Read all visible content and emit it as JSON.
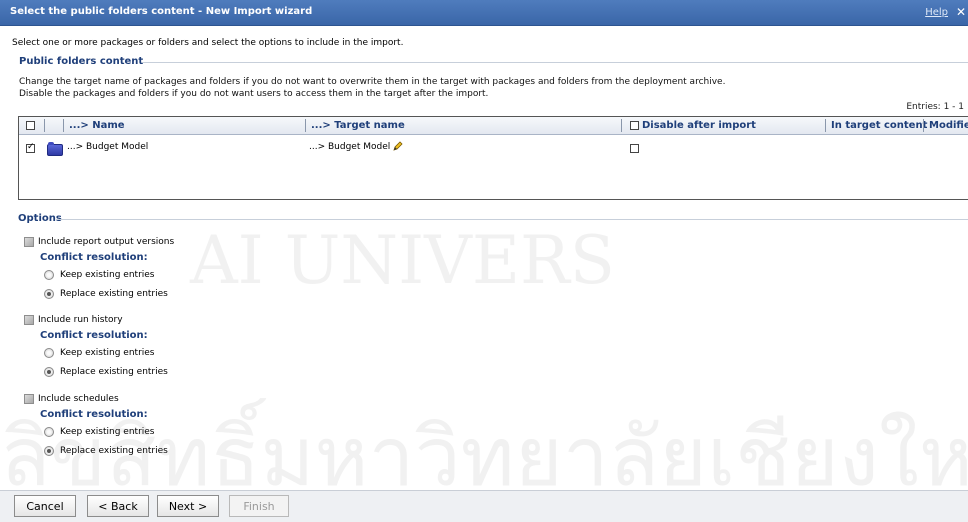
{
  "window": {
    "title": "Select the public folders content - New Import wizard",
    "help": "Help",
    "close": "✕"
  },
  "intro": "Select one or more packages or folders and select the options to include in the import.",
  "public_folders": {
    "title": "Public folders content",
    "desc1": "Change the target name of packages and folders if you do not want to overwrite them in the target with packages and folders from the deployment archive.",
    "desc2": "Disable the packages and folders if you do not want users to access them in the target after the import.",
    "entries": "Entries: 1 - 1",
    "columns": {
      "name": "...> Name",
      "target": "...> Target name",
      "disable": "Disable after import",
      "in_target": "In target content",
      "modified": "Modified"
    },
    "rows": [
      {
        "name": "...> Budget Model",
        "target": "...> Budget Model",
        "selected": true,
        "disable": false
      }
    ]
  },
  "options": {
    "title": "Options",
    "conflict_label": "Conflict resolution:",
    "keep": "Keep existing entries",
    "replace": "Replace existing entries",
    "groups": [
      {
        "label": "Include report output versions"
      },
      {
        "label": "Include run history"
      },
      {
        "label": "Include schedules"
      }
    ]
  },
  "footer": {
    "cancel": "Cancel",
    "back": "< Back",
    "next": "Next >",
    "finish": "Finish"
  },
  "watermark": {
    "line1": "AI UNIVERS",
    "line2": "ลิขสิทธิ์มหาวิทยาลัยเชียงใหม่"
  }
}
